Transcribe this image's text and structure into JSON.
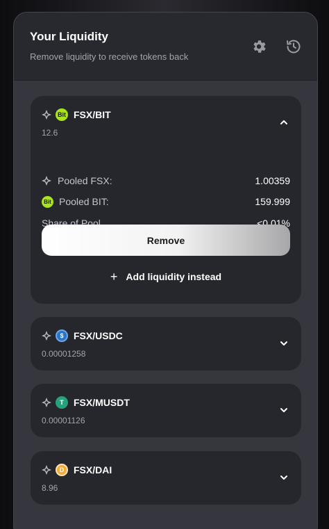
{
  "header": {
    "title": "Your Liquidity",
    "subtitle": "Remove liquidity to receive tokens back",
    "settings_icon": "gear-icon",
    "history_icon": "history-icon"
  },
  "positions": [
    {
      "pair": "FSX/BIT",
      "amount": "12.6",
      "token_badge": "Bit",
      "expanded": true,
      "details": {
        "pooled_a_label": "Pooled FSX:",
        "pooled_a_value": "1.00359",
        "pooled_b_label": "Pooled BIT:",
        "pooled_b_value": "159.999",
        "share_label": "Share of Pool",
        "share_value": "<0.01%"
      },
      "remove_label": "Remove",
      "add_label": "Add liquidity instead"
    },
    {
      "pair": "FSX/USDC",
      "amount": "0.00001258",
      "token_badge": "$",
      "expanded": false
    },
    {
      "pair": "FSX/MUSDT",
      "amount": "0.00001126",
      "token_badge": "T",
      "expanded": false
    },
    {
      "pair": "FSX/DAI",
      "amount": "8.96",
      "token_badge": "D",
      "expanded": false
    }
  ],
  "colors": {
    "panel": "#35363e",
    "card": "#26272d",
    "bit": "#a8e51f",
    "usdc": "#2775ca",
    "musdt": "#26a17b",
    "dai": "#f5ac37"
  }
}
